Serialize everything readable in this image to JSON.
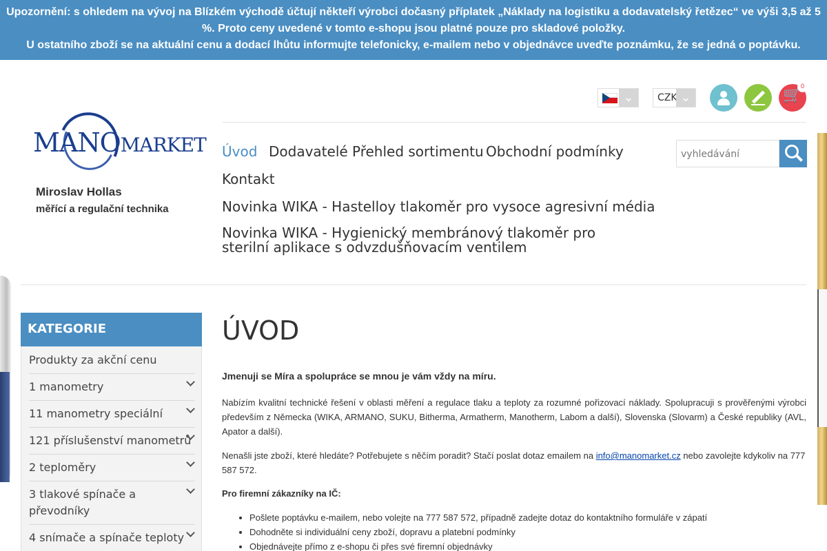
{
  "notice": {
    "line1": "Upozornění: s ohledem na vývoj na Blízkém východě účtují někteří výrobci dočasný příplatek „Náklady na logistiku a dodavatelský řetězec“ ve výši 3,5 až 5 %. Proto ceny uvedené v tomto e-shopu jsou platné pouze pro skladové položky.",
    "line2": "U ostatního zboží se na aktuální cenu a dodací lhůtu informujte telefonicky, e-mailem nebo v objednávce uveďte poznámku, že se jedná o poptávku."
  },
  "logo": {
    "brand_main": "MANO",
    "brand_tail": "MARKET",
    "owner": "Miroslav Hollas",
    "tagline": "měřící a regulační technika"
  },
  "header": {
    "currency": "CZK",
    "cart_count": "0"
  },
  "nav": {
    "items": [
      {
        "label": "Úvod",
        "active": true
      },
      {
        "label": "Dodavatelé"
      },
      {
        "label": "Přehled sortimentu"
      },
      {
        "label": "Obchodní podmínky"
      },
      {
        "label": "Kontakt"
      },
      {
        "label": "Novinka WIKA - Hastelloy tlakoměr pro vysoce agresivní média"
      },
      {
        "label": "Novinka WIKA - Hygienický membránový tlakoměr pro sterilní aplikace s odvzdušňovacím ventilem"
      }
    ]
  },
  "search": {
    "placeholder": "vyhledávání"
  },
  "sidebar": {
    "title": "KATEGORIE",
    "items": [
      {
        "label": "Produkty za akční cenu"
      },
      {
        "label": "1 manometry"
      },
      {
        "label": "11 manometry speciální"
      },
      {
        "label": "121 příslušenství manometrů"
      },
      {
        "label": "2 teploměry"
      },
      {
        "label": "3 tlakové spínače a převodníky"
      },
      {
        "label": "4 snímače a spínače teploty"
      }
    ]
  },
  "main": {
    "title": "ÚVOD",
    "lead": "Jmenuji se Míra a spolupráce se mnou je vám vždy na míru.",
    "p1": "Nabízím kvalitní technické řešení v oblasti měření a regulace tlaku a teploty za rozumné pořizovací náklady. Spolupracuji s prověřenými výrobci především z Německa (WIKA, ARMANO, SUKU, Bitherma, Armatherm, Manotherm, Labom a další), Slovenska (Slovarm) a České republiky (AVL, Apator a další).",
    "p2_before": "Nenašli jste zboží, které hledáte? Potřebujete s něčím poradit? Stačí poslat dotaz emailem na ",
    "p2_email": "info@manomarket.cz",
    "p2_after": " nebo zavolejte kdykoliv na 777 587 572.",
    "firm_heading": "Pro firemní zákazníky na IČ:",
    "bullets": [
      "Pošlete poptávku e-mailem, nebo volejte na 777 587 572, případně zadejte dotaz do kontaktního formuláře v zápatí",
      "Dohodněte si individuální ceny zboží, dopravu a platební podmínky",
      "Objednávejte přímo z e-shopu či přes své firemní objednávky"
    ]
  },
  "colors": {
    "accent": "#4a8ec2",
    "brand_blue": "#1a3e8f",
    "user_icon": "#6fc1cf",
    "edit_icon": "#8dc63f",
    "cart_icon": "#e8434f"
  }
}
